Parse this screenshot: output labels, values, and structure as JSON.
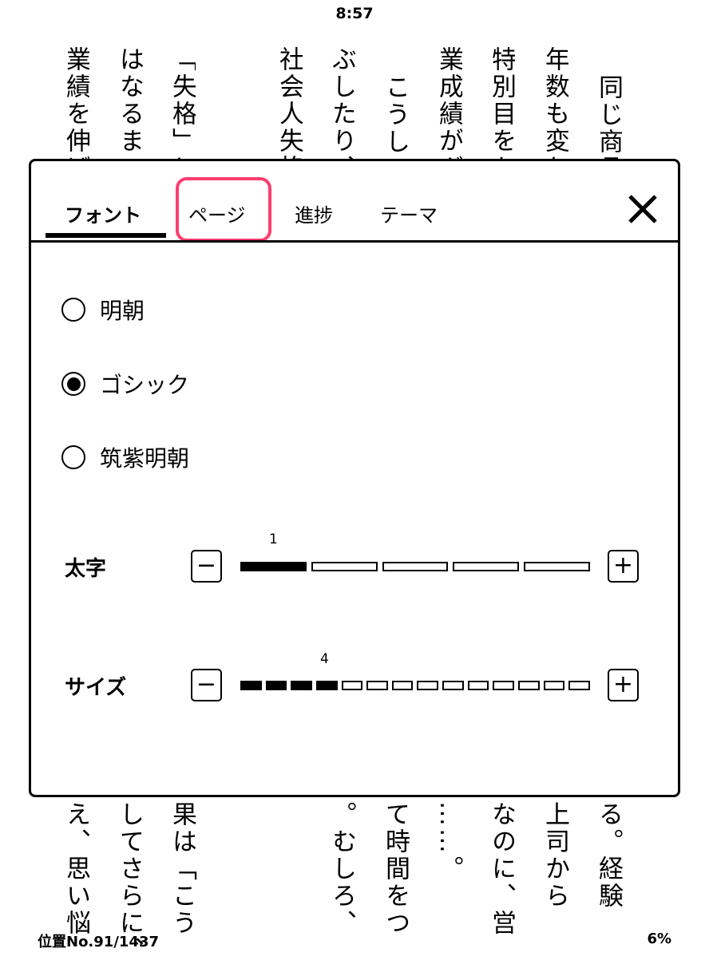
{
  "status_bar": {
    "time": "8:57"
  },
  "book": {
    "top_columns": [
      "同じ商品",
      "年数も変わ",
      "特別目をか",
      "業成績がグ",
      "こうして",
      "ぶしたり、",
      "社会人失格",
      "",
      "「失格」と",
      "はなるまい",
      "業績を伸ば"
    ],
    "bottom_columns": [
      "る。経験",
      "上司から",
      "なのに、営",
      "……。",
      "て時間をつ",
      "。むしろ、",
      "",
      "",
      "果は「こう",
      "してさらに、",
      "え、思い悩"
    ]
  },
  "settings_panel": {
    "tabs": [
      {
        "label": "フォント",
        "active": true
      },
      {
        "label": "ページ",
        "active": false,
        "highlighted": true
      },
      {
        "label": "進捗",
        "active": false
      },
      {
        "label": "テーマ",
        "active": false
      }
    ],
    "highlight_color": "#ff3d6e",
    "close_icon": "close-icon",
    "fonts": [
      {
        "label": "明朝",
        "selected": false
      },
      {
        "label": "ゴシック",
        "selected": true
      },
      {
        "label": "筑紫明朝",
        "selected": false
      }
    ],
    "bold": {
      "label": "太字",
      "value": "1",
      "level": 1,
      "max": 5,
      "minus": "−",
      "plus": "+"
    },
    "size": {
      "label": "サイズ",
      "value": "4",
      "level": 4,
      "max": 14,
      "minus": "−",
      "plus": "+"
    }
  },
  "footer": {
    "location": "位置No.91/1437",
    "percent": "6%"
  }
}
